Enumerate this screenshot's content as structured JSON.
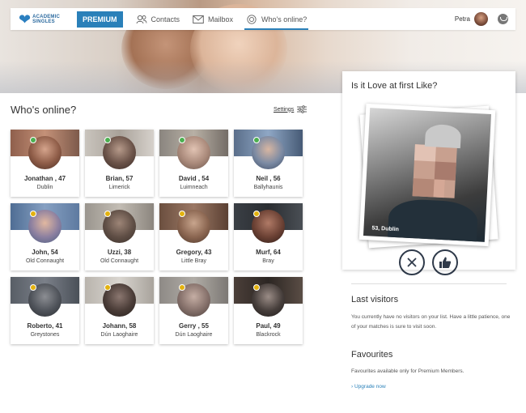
{
  "header": {
    "logo_line1": "ACADEMIC",
    "logo_line2": "SINGLES",
    "premium_label": "PREMIUM",
    "nav": [
      {
        "label": "Contacts",
        "icon": "contacts-icon"
      },
      {
        "label": "Mailbox",
        "icon": "mail-icon"
      },
      {
        "label": "Who's online?",
        "icon": "target-icon"
      }
    ],
    "user_name": "Petra"
  },
  "main": {
    "title": "Who's online?",
    "settings_label": "Settings",
    "profiles": [
      {
        "name": "Jonathan , 47",
        "city": "Dublin",
        "status": "online"
      },
      {
        "name": "Brian, 57",
        "city": "Limerick",
        "status": "online"
      },
      {
        "name": "David , 54",
        "city": "Luimneach",
        "status": "online"
      },
      {
        "name": "Neil , 56",
        "city": "Ballyhaunis",
        "status": "online"
      },
      {
        "name": "John, 54",
        "city": "Old Connaught",
        "status": "away"
      },
      {
        "name": "Uzzi, 38",
        "city": "Old Connaught",
        "status": "away"
      },
      {
        "name": "Gregory, 43",
        "city": "Little Bray",
        "status": "away"
      },
      {
        "name": "Murf, 64",
        "city": "Bray",
        "status": "away"
      },
      {
        "name": "Roberto, 41",
        "city": "Greystones",
        "status": "away"
      },
      {
        "name": "Johann, 58",
        "city": "Dún Laoghaire",
        "status": "away"
      },
      {
        "name": "Gerry , 55",
        "city": "Dún Laoghaire",
        "status": "away"
      },
      {
        "name": "Paul, 49",
        "city": "Blackrock",
        "status": "away"
      }
    ],
    "status_colors": {
      "online": "#4caf50",
      "away": "#e3b20f"
    }
  },
  "sidebar": {
    "love_title": "Is it Love at first Like?",
    "photo_label": "53, Dublin",
    "last_visitors_title": "Last visitors",
    "last_visitors_text": "You currently have no visitors on your list. Have a little patience, one of your matches is sure to visit soon.",
    "favourites_title": "Favourites",
    "favourites_text": "Favourites available only for Premium Members.",
    "upgrade_label": "Upgrade now"
  }
}
